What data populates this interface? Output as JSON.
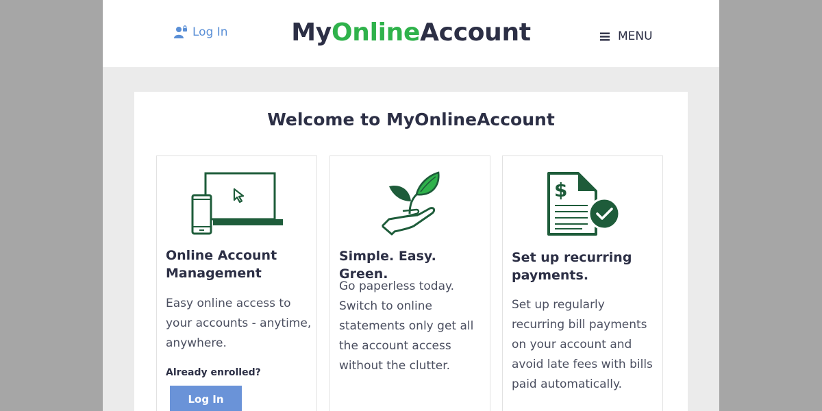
{
  "header": {
    "login_label": "Log In",
    "brand": {
      "part1": "My",
      "part2": "Online",
      "part3": "Account"
    },
    "menu_label": "MENU"
  },
  "main": {
    "welcome_title": "Welcome to MyOnlineAccount",
    "cards": [
      {
        "title": "Online Account Management",
        "text": "Easy online access to your accounts - anytime, anywhere.",
        "enrolled_label": "Already enrolled?",
        "button_label": "Log In",
        "icon": "devices-icon"
      },
      {
        "title": "Simple. Easy. Green.",
        "text": "Go paperless today. Switch to online statements only get all the account access without the clutter.",
        "icon": "plant-hand-icon"
      },
      {
        "title": "Set up recurring payments.",
        "text": "Set up regularly recurring bill payments on your account and avoid late fees with bills paid automatically.",
        "icon": "invoice-check-icon"
      }
    ]
  },
  "colors": {
    "brand_dark": "#2c2f45",
    "brand_green": "#2fb24b",
    "icon_green": "#1e5c3a",
    "link_blue": "#5a8fd6",
    "button_blue": "#6a93d8",
    "page_bg": "#ebebeb",
    "outer_bg": "#a6a6a6"
  }
}
